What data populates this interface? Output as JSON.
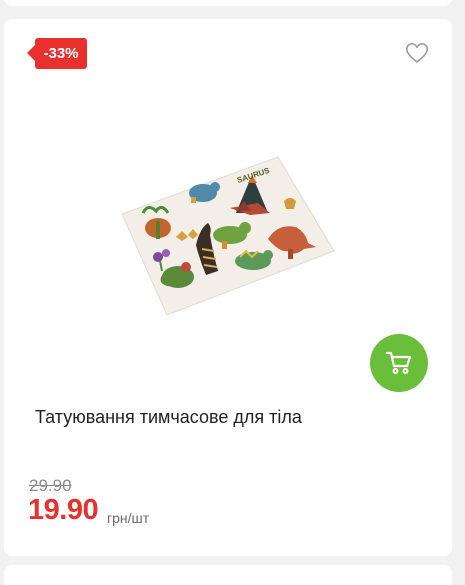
{
  "product": {
    "discount_badge": "-33%",
    "title": "Татуювання тимчасове для тіла",
    "old_price": "29.90",
    "price": "19.90",
    "price_unit": "грн/шт",
    "image_sticker_text": "SAURUS"
  },
  "icons": {
    "wishlist": "heart-outline-icon",
    "cart": "shopping-cart-icon"
  },
  "colors": {
    "badge": "#e8312e",
    "price": "#e8312e",
    "cart_button": "#6abe3a"
  }
}
